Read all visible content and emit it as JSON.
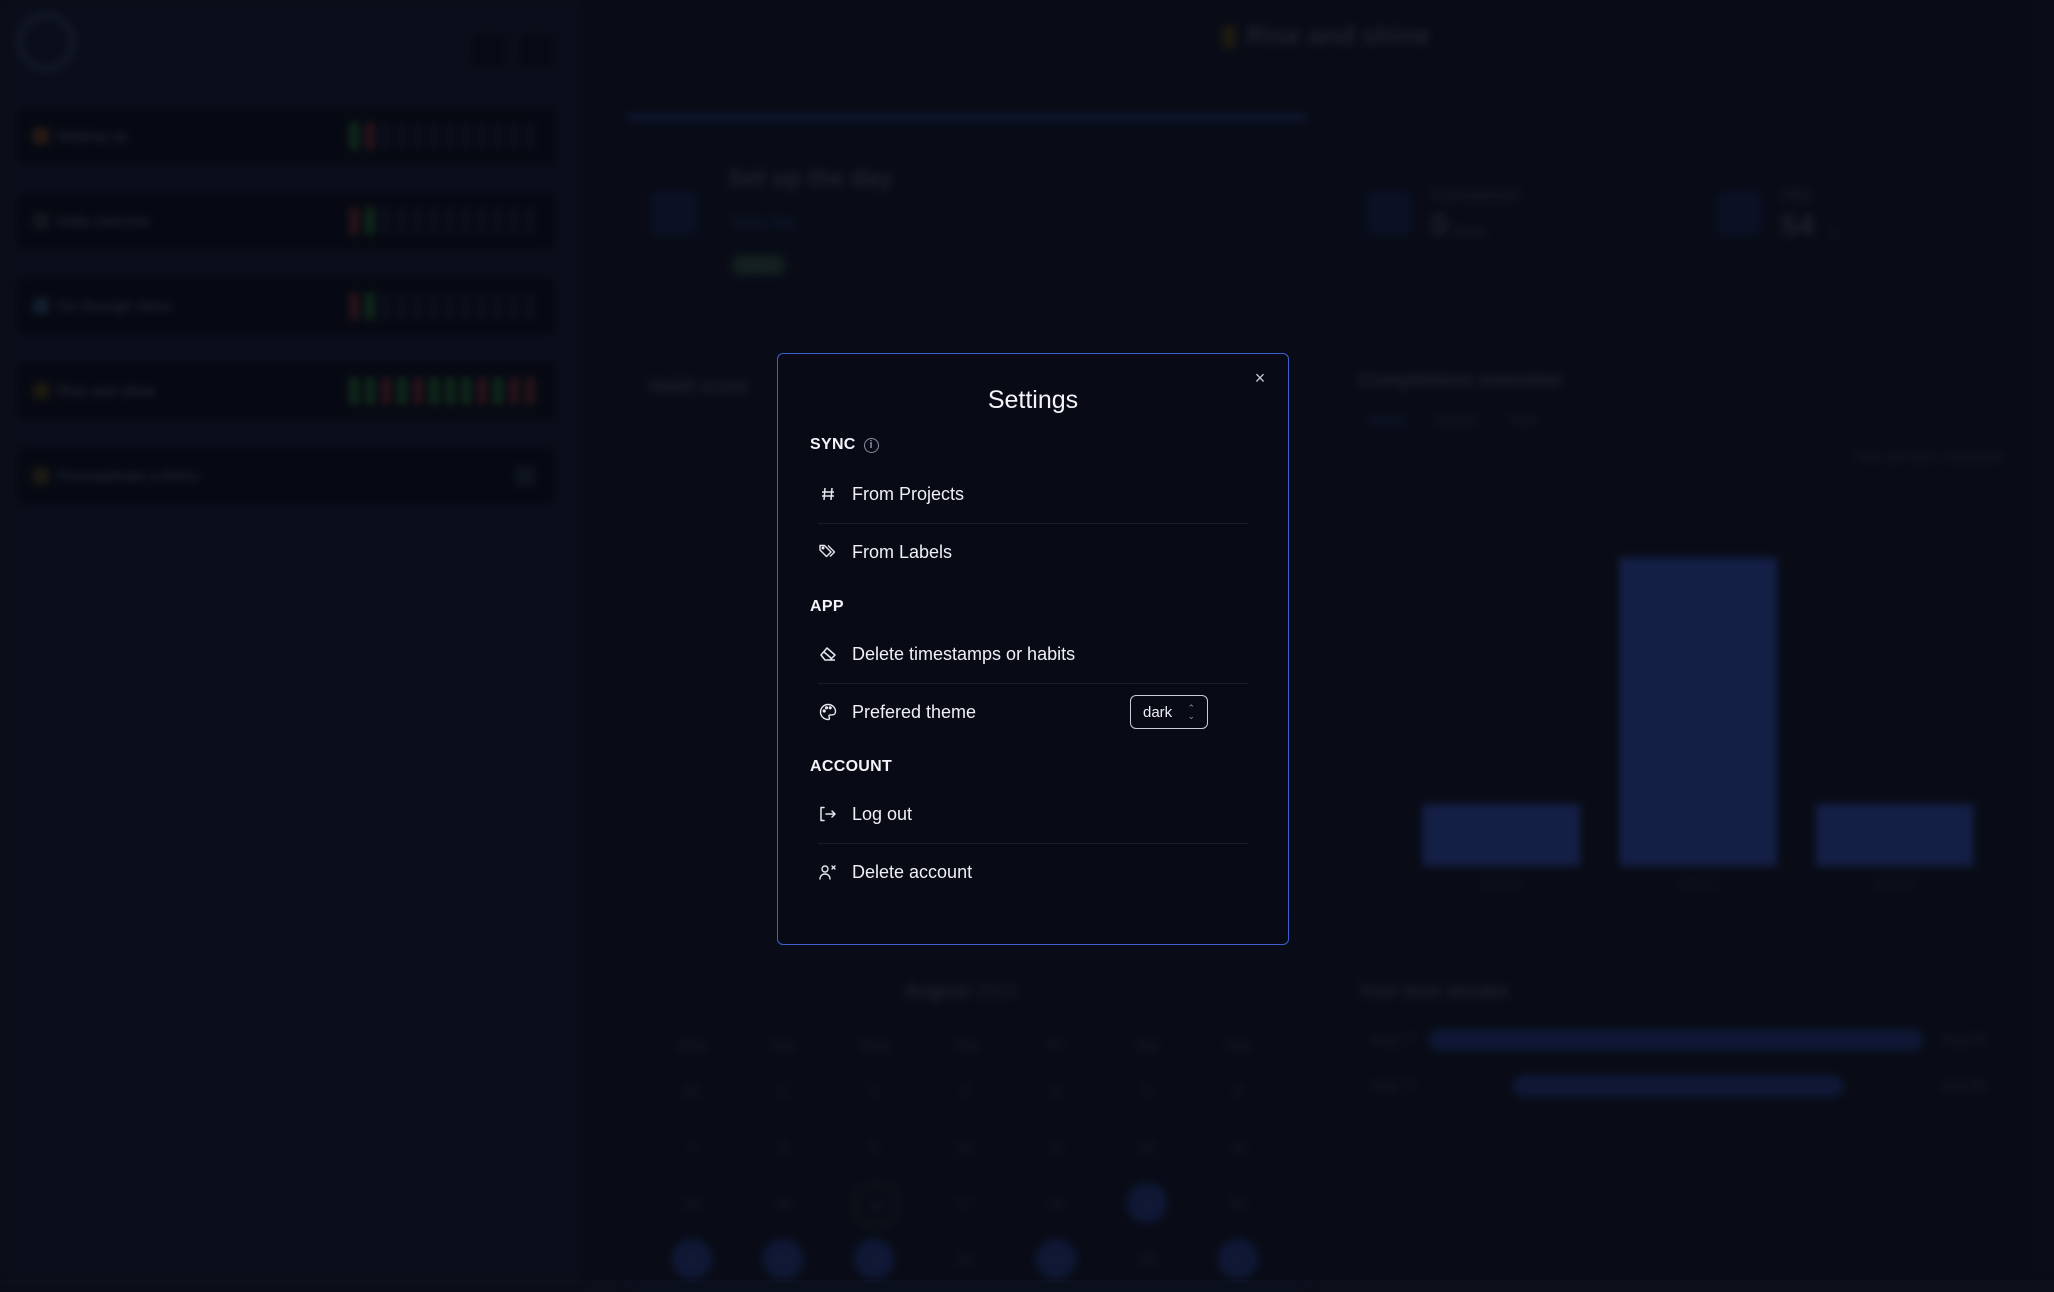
{
  "background": {
    "header_title": "Rise and shine",
    "sidebar": {
      "habits": [
        {
          "name": "Waking up",
          "ticks": [
            "g",
            "r",
            "",
            "",
            "",
            "",
            "",
            "",
            "",
            "",
            "",
            ""
          ]
        },
        {
          "name": "Daily exercise",
          "ticks": [
            "r",
            "g",
            "",
            "",
            "",
            "",
            "",
            "",
            "",
            "",
            "",
            ""
          ]
        },
        {
          "name": "Go through inbox",
          "ticks": [
            "r",
            "g",
            "",
            "",
            "",
            "",
            "",
            "",
            "",
            "",
            "",
            ""
          ]
        },
        {
          "name": "Rise and shine",
          "ticks": [
            "g",
            "g",
            "r",
            "g",
            "r",
            "g",
            "g",
            "g",
            "r",
            "g",
            "r",
            "r"
          ]
        },
        {
          "name": "Procrastinate a Retro",
          "ticks": []
        }
      ]
    },
    "today_card": {
      "title": "Set up the day",
      "chip": "Every day",
      "badge": "Done"
    },
    "completed_card": {
      "label": "Completed",
      "value": "0",
      "unit": "times"
    },
    "hits_card": {
      "label": "Hits",
      "value": "54",
      "unit": "s"
    },
    "habit_score": {
      "title": "Habit score"
    },
    "completions": {
      "title": "Completions overview",
      "tabs": [
        "Week",
        "Month",
        "Year"
      ],
      "legend": "Rise and shine completions"
    },
    "calendar": {
      "month": "August",
      "year": "2023",
      "dow": [
        "Mon",
        "Tue",
        "Wed",
        "Thu",
        "Fri",
        "Sat",
        "Sun"
      ],
      "weeks": [
        [
          "31",
          "1",
          "2",
          "3",
          "4",
          "5",
          "6"
        ],
        [
          "7",
          "8",
          "9",
          "10",
          "11",
          "12",
          "13"
        ],
        [
          "14",
          "15",
          "16",
          "17",
          "18",
          "19",
          "20"
        ],
        [
          "21",
          "22",
          "23",
          "24",
          "25",
          "26",
          "27"
        ]
      ]
    },
    "streaks": {
      "title": "Your best streaks",
      "rows": [
        {
          "start": "Aug 17",
          "end": "Aug 23",
          "value": "5"
        },
        {
          "start": "Aug 17",
          "end": "Aug 25",
          "value": "3"
        }
      ]
    }
  },
  "chart_data": {
    "type": "bar",
    "title": "Completions overview",
    "categories": [
      "Aug 14",
      "Aug 21",
      "Aug 28"
    ],
    "values": [
      1,
      5,
      1
    ],
    "ylim": [
      0,
      6
    ],
    "legend": "top-right"
  },
  "modal": {
    "title": "Settings",
    "close_label": "×",
    "sections": {
      "sync": {
        "heading": "SYNC",
        "items": [
          {
            "label": "From Projects",
            "icon": "hash-icon"
          },
          {
            "label": "From Labels",
            "icon": "tags-icon"
          }
        ]
      },
      "app": {
        "heading": "APP",
        "items": [
          {
            "label": "Delete timestamps or habits",
            "icon": "eraser-icon"
          },
          {
            "label": "Prefered theme",
            "icon": "palette-icon"
          }
        ],
        "theme_select": {
          "value": "dark"
        }
      },
      "account": {
        "heading": "ACCOUNT",
        "items": [
          {
            "label": "Log out",
            "icon": "logout-icon"
          },
          {
            "label": "Delete account",
            "icon": "user-x-icon"
          }
        ]
      }
    }
  },
  "colors": {
    "modal_border": "#3b5fd0",
    "background": "#0b0f1a",
    "bar": "#1d2b63"
  }
}
